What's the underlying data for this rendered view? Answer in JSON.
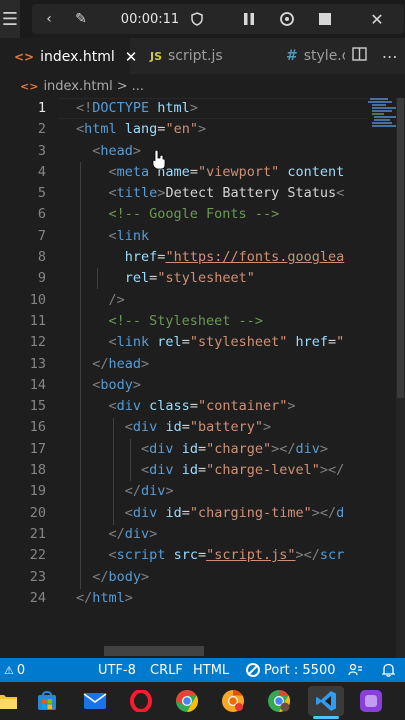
{
  "recorder": {
    "menu_icon": "hamburger-icon",
    "timer": "00:00:11",
    "icons": [
      "collapse-left-icon",
      "pen-icon",
      "shield-icon",
      "pause-icon",
      "restart-icon",
      "stop-icon",
      "close-icon"
    ]
  },
  "tabs": [
    {
      "label": "index.html",
      "icon": "<>",
      "icon_color": "#e37933",
      "active": true
    },
    {
      "label": "script.js",
      "icon": "JS",
      "icon_color": "#cbcb41",
      "active": false
    },
    {
      "label": "style.c",
      "icon": "#",
      "icon_color": "#519aba",
      "active": false
    }
  ],
  "breadcrumb": {
    "icon": "<>",
    "file": "index.html",
    "sep": ">",
    "more": "..."
  },
  "editor": {
    "current_line": 1,
    "line_numbers": [
      "1",
      "2",
      "3",
      "4",
      "5",
      "6",
      "7",
      "8",
      "9",
      "10",
      "11",
      "12",
      "13",
      "14",
      "15",
      "16",
      "17",
      "18",
      "19",
      "20",
      "21",
      "22",
      "23",
      "24"
    ],
    "lines": [
      [
        [
          "p",
          "<!"
        ],
        [
          "tag",
          "DOCTYPE "
        ],
        [
          "attr",
          "html"
        ],
        [
          "p",
          ">"
        ]
      ],
      [
        [
          "p",
          "<"
        ],
        [
          "tag",
          "html "
        ],
        [
          "attr",
          "lang"
        ],
        [
          "txt",
          "="
        ],
        [
          "str",
          "\"en\""
        ],
        [
          "p",
          ">"
        ]
      ],
      [
        [
          "txt",
          "  "
        ],
        [
          "p",
          "<"
        ],
        [
          "tag",
          "head"
        ],
        [
          "p",
          ">"
        ]
      ],
      [
        [
          "txt",
          "    "
        ],
        [
          "p",
          "<"
        ],
        [
          "tag",
          "meta "
        ],
        [
          "attr",
          "name"
        ],
        [
          "txt",
          "="
        ],
        [
          "str",
          "\"viewport\" "
        ],
        [
          "attr",
          "content"
        ]
      ],
      [
        [
          "txt",
          "    "
        ],
        [
          "p",
          "<"
        ],
        [
          "tag",
          "title"
        ],
        [
          "p",
          ">"
        ],
        [
          "txt",
          "Detect Battery Status"
        ],
        [
          "p",
          "<"
        ]
      ],
      [
        [
          "txt",
          "    "
        ],
        [
          "com",
          "<!-- Google Fonts -->"
        ]
      ],
      [
        [
          "txt",
          "    "
        ],
        [
          "p",
          "<"
        ],
        [
          "tag",
          "link"
        ]
      ],
      [
        [
          "txt",
          "      "
        ],
        [
          "attr",
          "href"
        ],
        [
          "txt",
          "="
        ],
        [
          "url",
          "\"https://fonts.googlea"
        ]
      ],
      [
        [
          "txt",
          "      "
        ],
        [
          "attr",
          "rel"
        ],
        [
          "txt",
          "="
        ],
        [
          "str",
          "\"stylesheet\""
        ]
      ],
      [
        [
          "txt",
          "    "
        ],
        [
          "p",
          "/>"
        ]
      ],
      [
        [
          "txt",
          "    "
        ],
        [
          "com",
          "<!-- Stylesheet -->"
        ]
      ],
      [
        [
          "txt",
          "    "
        ],
        [
          "p",
          "<"
        ],
        [
          "tag",
          "link "
        ],
        [
          "attr",
          "rel"
        ],
        [
          "txt",
          "="
        ],
        [
          "str",
          "\"stylesheet\" "
        ],
        [
          "attr",
          "href"
        ],
        [
          "txt",
          "="
        ],
        [
          "str",
          "\""
        ]
      ],
      [
        [
          "txt",
          "  "
        ],
        [
          "p",
          "</"
        ],
        [
          "tag",
          "head"
        ],
        [
          "p",
          ">"
        ]
      ],
      [
        [
          "txt",
          "  "
        ],
        [
          "p",
          "<"
        ],
        [
          "tag",
          "body"
        ],
        [
          "p",
          ">"
        ]
      ],
      [
        [
          "txt",
          "    "
        ],
        [
          "p",
          "<"
        ],
        [
          "tag",
          "div "
        ],
        [
          "attr",
          "class"
        ],
        [
          "txt",
          "="
        ],
        [
          "str",
          "\"container\""
        ],
        [
          "p",
          ">"
        ]
      ],
      [
        [
          "txt",
          "      "
        ],
        [
          "p",
          "<"
        ],
        [
          "tag",
          "div "
        ],
        [
          "attr",
          "id"
        ],
        [
          "txt",
          "="
        ],
        [
          "str",
          "\"battery\""
        ],
        [
          "p",
          ">"
        ]
      ],
      [
        [
          "txt",
          "        "
        ],
        [
          "p",
          "<"
        ],
        [
          "tag",
          "div "
        ],
        [
          "attr",
          "id"
        ],
        [
          "txt",
          "="
        ],
        [
          "str",
          "\"charge\""
        ],
        [
          "p",
          "></"
        ],
        [
          "tag",
          "div"
        ],
        [
          "p",
          ">"
        ]
      ],
      [
        [
          "txt",
          "        "
        ],
        [
          "p",
          "<"
        ],
        [
          "tag",
          "div "
        ],
        [
          "attr",
          "id"
        ],
        [
          "txt",
          "="
        ],
        [
          "str",
          "\"charge-level\""
        ],
        [
          "p",
          "></"
        ]
      ],
      [
        [
          "txt",
          "      "
        ],
        [
          "p",
          "</"
        ],
        [
          "tag",
          "div"
        ],
        [
          "p",
          ">"
        ]
      ],
      [
        [
          "txt",
          "      "
        ],
        [
          "p",
          "<"
        ],
        [
          "tag",
          "div "
        ],
        [
          "attr",
          "id"
        ],
        [
          "txt",
          "="
        ],
        [
          "str",
          "\"charging-time\""
        ],
        [
          "p",
          "></"
        ],
        [
          "tag",
          "d"
        ]
      ],
      [
        [
          "txt",
          "    "
        ],
        [
          "p",
          "</"
        ],
        [
          "tag",
          "div"
        ],
        [
          "p",
          ">"
        ]
      ],
      [
        [
          "txt",
          "    "
        ],
        [
          "p",
          "<"
        ],
        [
          "tag",
          "script "
        ],
        [
          "attr",
          "src"
        ],
        [
          "txt",
          "="
        ],
        [
          "url",
          "\"script.js\""
        ],
        [
          "p",
          "></"
        ],
        [
          "tag",
          "scr"
        ]
      ],
      [
        [
          "txt",
          "  "
        ],
        [
          "p",
          "</"
        ],
        [
          "tag",
          "body"
        ],
        [
          "p",
          ">"
        ]
      ],
      [
        [
          "p",
          "</"
        ],
        [
          "tag",
          "html"
        ],
        [
          "p",
          ">"
        ]
      ]
    ]
  },
  "statusbar": {
    "problems": "0",
    "encoding": "UTF-8",
    "eol": "CRLF",
    "language": "HTML",
    "port": "Port : 5500"
  },
  "taskbar": [
    {
      "name": "file-explorer-icon",
      "color": "#f4c430"
    },
    {
      "name": "store-icon",
      "color": "#2b88d8"
    },
    {
      "name": "mail-icon",
      "color": "#1a73e8"
    },
    {
      "name": "opera-icon",
      "color": "#ff1b2d"
    },
    {
      "name": "chrome-icon",
      "color": "#34a853"
    },
    {
      "name": "chrome-canary-icon",
      "color": "#f9a825"
    },
    {
      "name": "chrome-profile-icon",
      "color": "#4285f4"
    },
    {
      "name": "vscode-icon",
      "color": "#2f9cf0",
      "active": true
    },
    {
      "name": "app-purple-icon",
      "color": "#8b3fd9"
    }
  ]
}
